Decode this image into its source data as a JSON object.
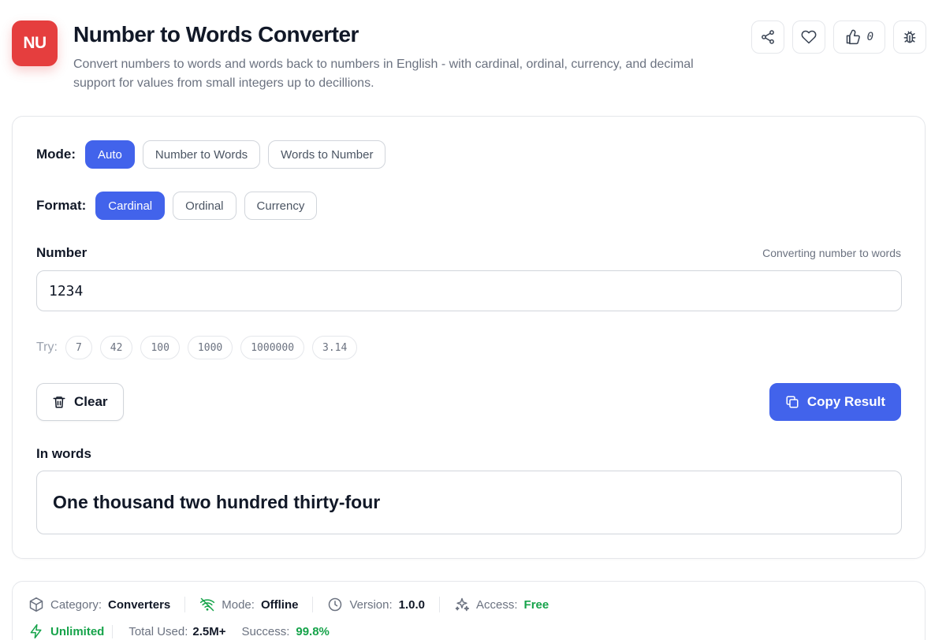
{
  "header": {
    "logo_text": "NU",
    "title": "Number to Words Converter",
    "subtitle": "Convert numbers to words and words back to numbers in English - with cardinal, ordinal, currency, and decimal support for values from small integers up to decillions.",
    "like_count": "0"
  },
  "mode": {
    "label": "Mode:",
    "options": [
      "Auto",
      "Number to Words",
      "Words to Number"
    ],
    "selected": "Auto"
  },
  "format": {
    "label": "Format:",
    "options": [
      "Cardinal",
      "Ordinal",
      "Currency"
    ],
    "selected": "Cardinal"
  },
  "input": {
    "label": "Number",
    "hint": "Converting number to words",
    "value": "1234"
  },
  "try": {
    "label": "Try:",
    "examples": [
      "7",
      "42",
      "100",
      "1000",
      "1000000",
      "3.14"
    ]
  },
  "actions": {
    "clear_label": "Clear",
    "copy_label": "Copy Result"
  },
  "output": {
    "label": "In words",
    "value": "One thousand two hundred thirty-four"
  },
  "meta": {
    "category_label": "Category:",
    "category_value": "Converters",
    "mode_label": "Mode:",
    "mode_value": "Offline",
    "version_label": "Version:",
    "version_value": "1.0.0",
    "access_label": "Access:",
    "access_value": "Free",
    "unlimited_label": "Unlimited",
    "total_label": "Total Used:",
    "total_value": "2.5M+",
    "success_label": "Success:",
    "success_value": "99.8%"
  },
  "colors": {
    "accent": "#4263eb",
    "logo": "#e53e3e",
    "success": "#16a34a"
  },
  "icons": [
    "share-icon",
    "heart-icon",
    "thumbs-up-icon",
    "bug-icon",
    "trash-icon",
    "copy-icon",
    "cube-icon",
    "wifi-off-icon",
    "clock-icon",
    "sparkles-icon",
    "bolt-icon"
  ]
}
